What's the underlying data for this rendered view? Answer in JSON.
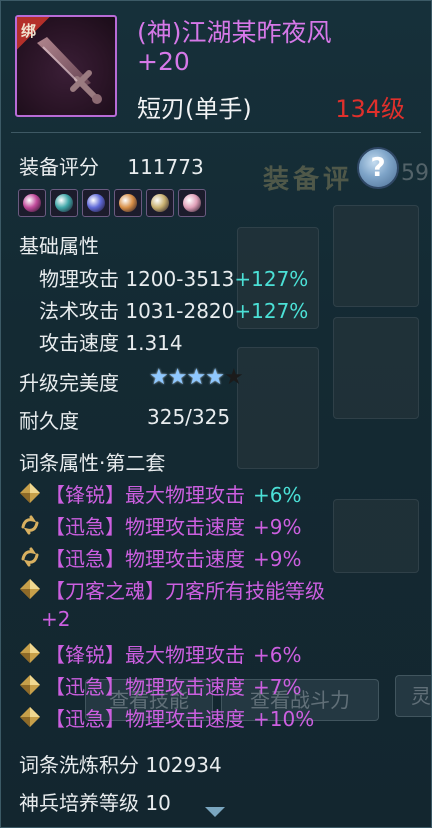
{
  "item": {
    "bind_tag": "绑",
    "name_line1": "(神)江湖某昨夜风",
    "name_line2": "+20",
    "type": "短刃(单手)",
    "level": "134级"
  },
  "score": {
    "label": "装备评分",
    "value": "111773"
  },
  "gems": [
    {
      "name": "gem-pink",
      "color": "#c04a9a"
    },
    {
      "name": "gem-teal",
      "color": "#3fa6a8"
    },
    {
      "name": "gem-blue",
      "color": "#5f6ad8"
    },
    {
      "name": "gem-gold-orb",
      "color": "#d89048"
    },
    {
      "name": "gem-pearl",
      "color": "#c8b070"
    },
    {
      "name": "gem-pink-cluster",
      "color": "#e0a0b8"
    }
  ],
  "base": {
    "title": "基础属性",
    "stats": [
      {
        "label": "物理攻击",
        "value": "1200-3513",
        "bonus": "+127%"
      },
      {
        "label": "法术攻击",
        "value": "1031-2820",
        "bonus": "+127%"
      },
      {
        "label": "攻击速度",
        "value": "1.314",
        "bonus": ""
      }
    ]
  },
  "upgrade": {
    "label": "升级完美度",
    "stars_on": 4,
    "stars_total": 5
  },
  "durability": {
    "label": "耐久度",
    "value": "325/325"
  },
  "affixes": {
    "title": "词条属性·第二套",
    "items": [
      {
        "icon": "diamond",
        "tag": "【锋锐】",
        "text": "最大物理攻击",
        "value": "+6%",
        "value_color": "cyan"
      },
      {
        "icon": "swirl",
        "tag": "【迅急】",
        "text": "物理攻击速度",
        "value": "+9%",
        "value_color": "purple"
      },
      {
        "icon": "swirl",
        "tag": "【迅急】",
        "text": "物理攻击速度",
        "value": "+9%",
        "value_color": "purple"
      },
      {
        "icon": "diamond",
        "tag": "【刀客之魂】",
        "text": "刀客所有技能等级",
        "value": "+2",
        "value_color": "purple"
      },
      {
        "icon": "diamond",
        "tag": "【锋锐】",
        "text": "最大物理攻击",
        "value": "+6%",
        "value_color": "purple"
      },
      {
        "icon": "diamond",
        "tag": "【迅急】",
        "text": "物理攻击速度",
        "value": "+7%",
        "value_color": "purple"
      },
      {
        "icon": "diamond",
        "tag": "【迅急】",
        "text": "物理攻击速度",
        "value": "+10%",
        "value_color": "purple"
      }
    ]
  },
  "refine": {
    "label": "词条洗炼积分",
    "value": "102934"
  },
  "cultivate": {
    "label": "神兵培养等级",
    "value": "10"
  },
  "background": {
    "score_text": "装备评",
    "score_num": "59",
    "btn1": "查看技能",
    "btn2": "查看战斗力",
    "btn3": "灵"
  },
  "colors": {
    "name": "#d678e8",
    "level": "#e0302c",
    "bonus": "#4be0d6",
    "affix": "#cc5fe0"
  }
}
